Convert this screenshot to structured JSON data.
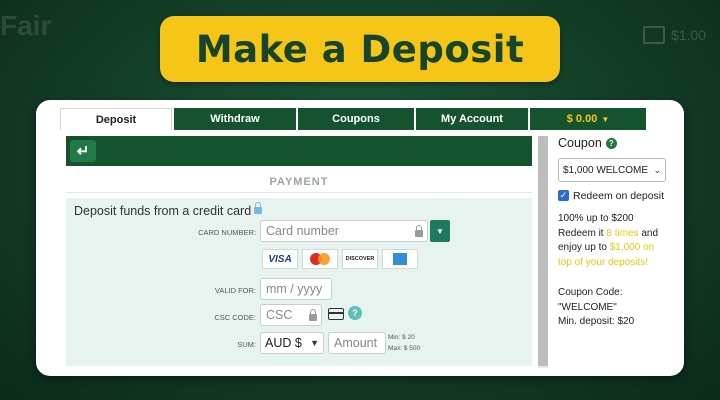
{
  "banner": {
    "title": "Make a Deposit"
  },
  "background": {
    "logo_text": "Fair",
    "balance": "$1.00"
  },
  "tabs": [
    {
      "label": "Deposit",
      "active": true
    },
    {
      "label": "Withdraw",
      "active": false
    },
    {
      "label": "Coupons",
      "active": false
    },
    {
      "label": "My Account",
      "active": false
    },
    {
      "label": "$ 0.00",
      "active": false
    }
  ],
  "back_button": {
    "glyph": "↵"
  },
  "payment": {
    "section_label": "PAYMENT",
    "form_title": "Deposit funds from a credit card",
    "card_number": {
      "label": "CARD NUMBER:",
      "placeholder": "Card number"
    },
    "card_brands": [
      "VISA",
      "MasterCard",
      "DISCOVER",
      "AMEX"
    ],
    "brand_visa": "VISA",
    "brand_discover": "DISCOVER",
    "valid_for": {
      "label": "VALID FOR:",
      "placeholder": "mm / yyyy"
    },
    "csc": {
      "label": "CSC CODE:",
      "placeholder": "CSC",
      "help": "?"
    },
    "sum": {
      "label": "SUM:",
      "currency": "AUD $",
      "amount_placeholder": "Amount",
      "min": "Min: $ 20",
      "max": "Max: $ 500"
    }
  },
  "coupon": {
    "heading": "Coupon",
    "help": "?",
    "selected": "$1,000 WELCOME",
    "redeem_label": "Redeem on deposit",
    "redeem_checked": true,
    "promo_part1": "100% up to $200 Redeem it ",
    "promo_highlight1": "8 times",
    "promo_part2": " and enjoy up to ",
    "promo_highlight2": "$1,000 on top of your deposits!",
    "code_label": "Coupon Code:",
    "code_value": "\"WELCOME\"",
    "min_deposit": "Min. deposit: $20"
  },
  "colors": {
    "brand_green": "#15532f",
    "accent_yellow": "#f5c518",
    "form_bg": "#e6f3ee",
    "teal_button": "#1c7a5e"
  }
}
